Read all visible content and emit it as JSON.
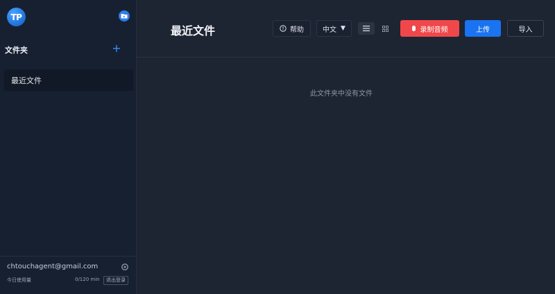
{
  "sidebar": {
    "logo_text": "TP",
    "logo_icon": "tp-logo-icon",
    "new_folder_icon": "folder-icon",
    "folders_title": "文件夹",
    "add_folder_symbol": "+",
    "items": [
      {
        "label": "最近文件",
        "active": true
      }
    ],
    "footer": {
      "email": "chtouchagent@gmail.com",
      "usage_label": "今日使用量",
      "usage_value": "0/120 min",
      "logout_label": "退出登录"
    }
  },
  "header": {
    "title": "最近文件",
    "help_label": "帮助",
    "language_value": "中文",
    "language_caret": "▼",
    "record_label": "录制音频",
    "upload_label": "上传",
    "import_label": "导入"
  },
  "main": {
    "empty_message": "此文件夹中没有文件"
  },
  "colors": {
    "background": "#1e2532",
    "sidebar": "#172031",
    "record": "#f0474a",
    "upload": "#1a73f0",
    "accent": "#3b8cff"
  }
}
